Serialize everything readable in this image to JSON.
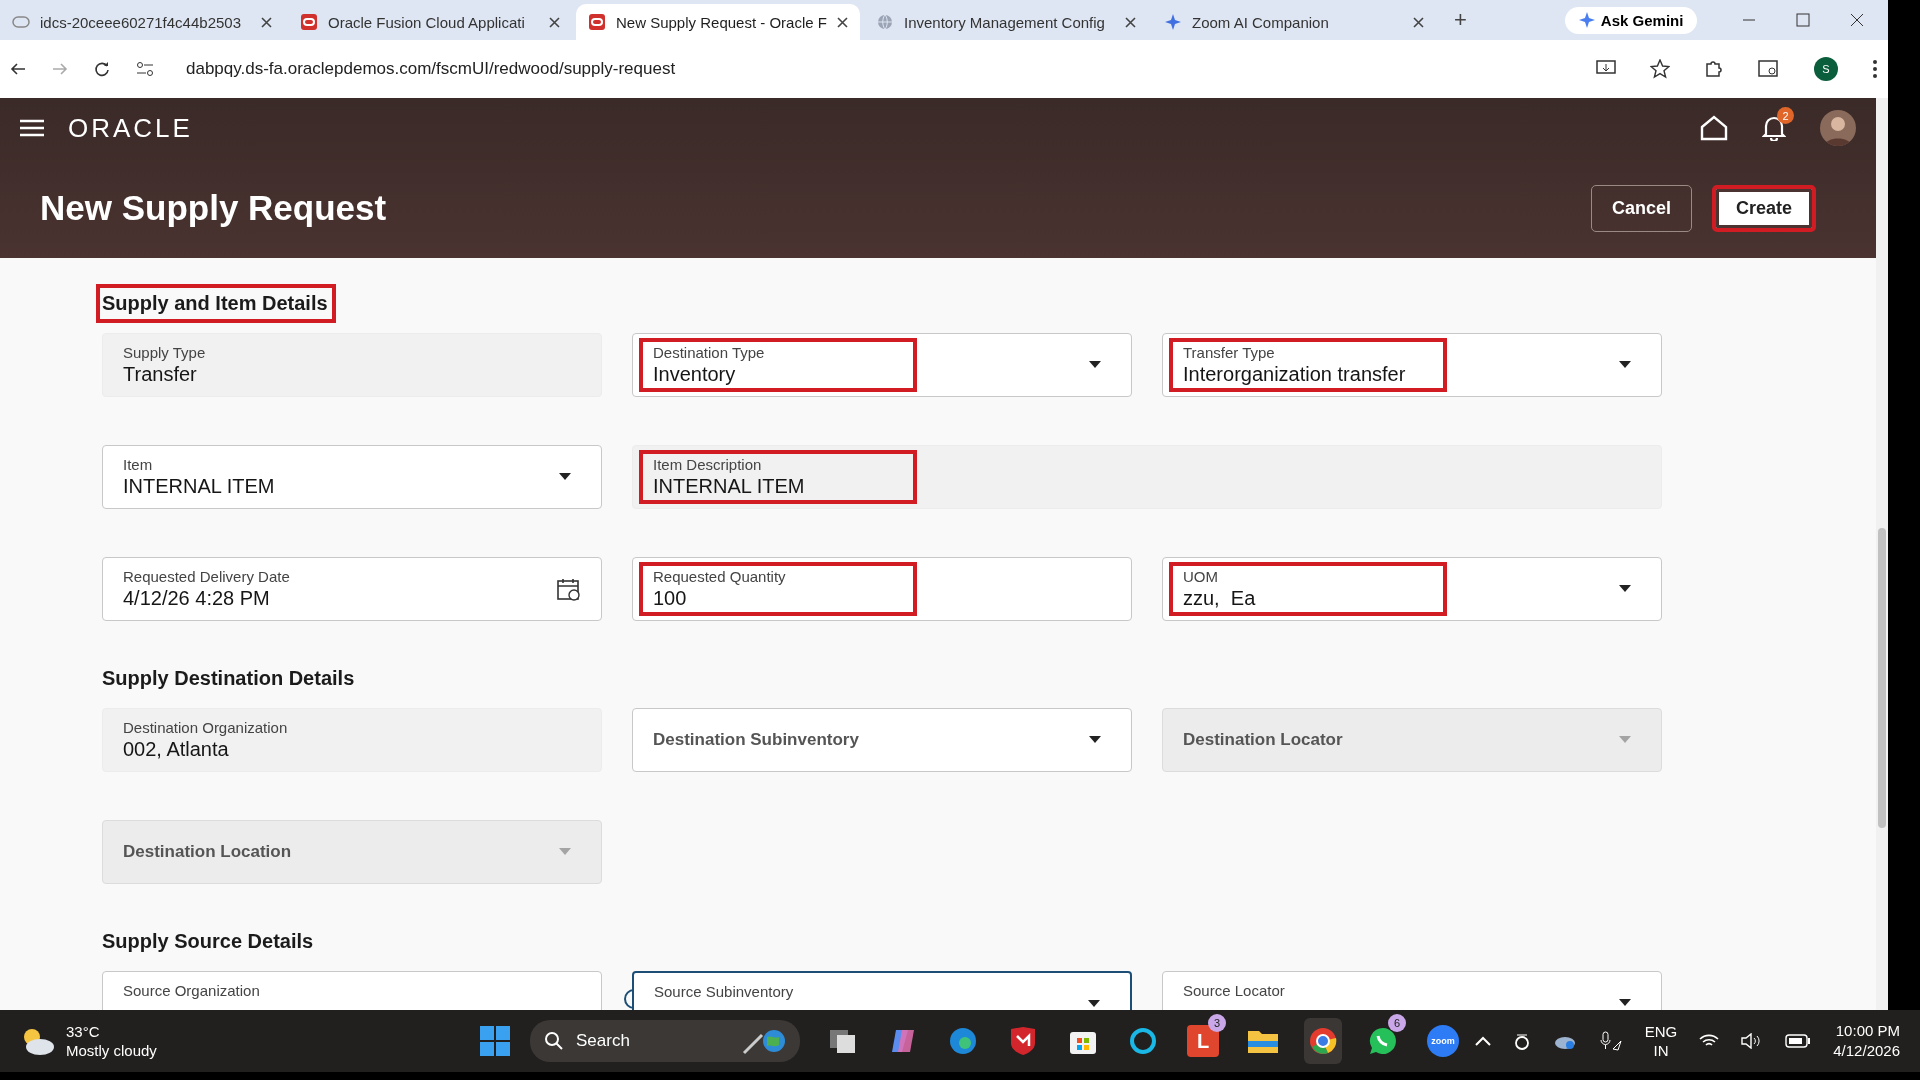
{
  "browser": {
    "tabs": [
      {
        "title": "idcs-20ceee60271f4c44b2503",
        "kind": "cloud",
        "selected": false
      },
      {
        "title": "Oracle Fusion Cloud Applicati",
        "kind": "oracle",
        "selected": false
      },
      {
        "title": "New Supply Request - Oracle F",
        "kind": "oracle",
        "selected": true
      },
      {
        "title": "Inventory Management Config",
        "kind": "globe",
        "selected": false
      },
      {
        "title": "Zoom AI Companion",
        "kind": "spark",
        "selected": false
      }
    ],
    "new_tab": "+",
    "gemini": "Ask Gemini",
    "url": "dabpqy.ds-fa.oraclepdemos.com/fscmUI/redwood/supply-request",
    "profile": "S"
  },
  "app": {
    "logo": "ORACLE",
    "notifications": "2",
    "title": "New Supply Request",
    "buttons": [
      {
        "label": "Cancel",
        "kind": "secondary",
        "highlighted": false
      },
      {
        "label": "Create",
        "kind": "primary",
        "highlighted": true
      }
    ]
  },
  "sections": [
    {
      "title": "Supply and Item Details",
      "highlighted": true,
      "fields": [
        {
          "label": "Supply Type",
          "value": "Transfer",
          "kind": "readonly",
          "highlighted": false
        },
        {
          "label": "Destination Type",
          "value": "Inventory",
          "kind": "select",
          "highlighted": true
        },
        {
          "label": "Transfer Type",
          "value": "Interorganization transfer",
          "kind": "select",
          "highlighted": true
        },
        {
          "label": "Item",
          "value": "INTERNAL ITEM",
          "kind": "select",
          "highlighted": false
        },
        {
          "label": "Item Description",
          "value": "INTERNAL ITEM",
          "kind": "readonly",
          "wide": true,
          "highlighted": true
        },
        {
          "label": "Requested Delivery Date",
          "value": "4/12/26 4:28 PM",
          "kind": "date",
          "highlighted": false
        },
        {
          "label": "Requested Quantity",
          "value": "100",
          "kind": "input",
          "highlighted": true
        },
        {
          "label": "UOM",
          "value": "zzu,  Ea",
          "kind": "select",
          "highlighted": true
        }
      ]
    },
    {
      "title": "Supply Destination Details",
      "highlighted": false,
      "fields": [
        {
          "label": "Destination Organization",
          "value": "002, Atlanta",
          "kind": "readonly",
          "highlighted": false
        },
        {
          "label": "Destination Subinventory",
          "kind": "select",
          "highlighted": false
        },
        {
          "label": "Destination Locator",
          "kind": "select",
          "disabled": true,
          "highlighted": false
        },
        {
          "label": "Destination Location",
          "kind": "select",
          "disabled": true,
          "highlighted": false
        }
      ]
    },
    {
      "title": "Supply Source Details",
      "highlighted": false,
      "fields": [
        {
          "label": "Source Organization",
          "kind": "search",
          "floating": true,
          "highlighted": false
        },
        {
          "label": "Source Subinventory",
          "kind": "select",
          "focused": true,
          "floating": true,
          "highlighted": false
        },
        {
          "label": "Source Locator",
          "kind": "select",
          "floating": true,
          "highlighted": false
        }
      ]
    }
  ],
  "taskbar": {
    "temperature": "33°C",
    "weather": "Mostly cloudy",
    "search": "Search",
    "apps": [
      {
        "kind": "files"
      },
      {
        "kind": "copilot"
      },
      {
        "kind": "edge"
      },
      {
        "kind": "shield"
      },
      {
        "kind": "store"
      },
      {
        "kind": "ring"
      },
      {
        "kind": "letter",
        "badge": "3",
        "letter": "L"
      },
      {
        "kind": "folder"
      },
      {
        "kind": "chrome",
        "active": true
      },
      {
        "kind": "chat",
        "badge": "6"
      },
      {
        "kind": "zoom",
        "letter": "zoom"
      }
    ],
    "language": "ENG",
    "region": "IN",
    "time": "10:00 PM",
    "date": "4/12/2026"
  }
}
